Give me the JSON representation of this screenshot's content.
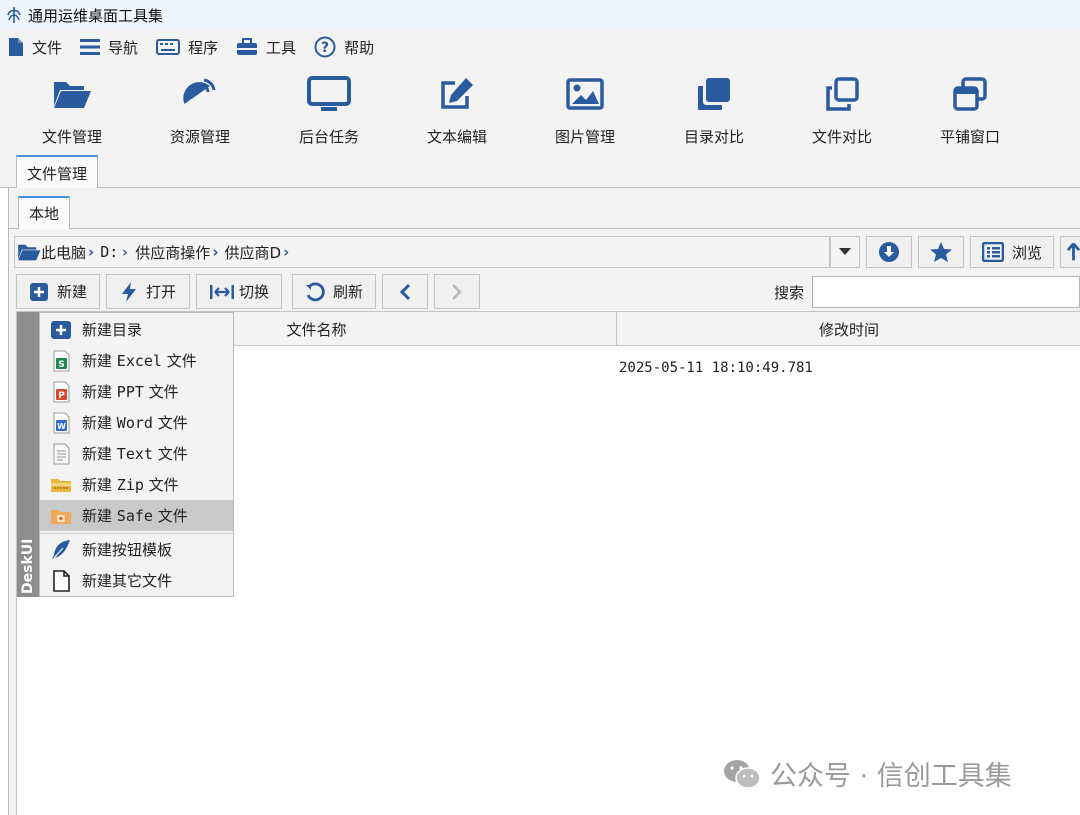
{
  "window": {
    "title": "通用运维桌面工具集"
  },
  "menu": [
    {
      "label": "文件",
      "icon": "file-icon"
    },
    {
      "label": "导航",
      "icon": "hamburger-icon"
    },
    {
      "label": "程序",
      "icon": "keyboard-icon"
    },
    {
      "label": "工具",
      "icon": "toolbox-icon"
    },
    {
      "label": "帮助",
      "icon": "help-icon"
    }
  ],
  "toolbar": [
    {
      "label": "文件管理",
      "icon": "folder-open-icon"
    },
    {
      "label": "资源管理",
      "icon": "satellite-icon"
    },
    {
      "label": "后台任务",
      "icon": "monitor-icon"
    },
    {
      "label": "文本编辑",
      "icon": "edit-icon"
    },
    {
      "label": "图片管理",
      "icon": "image-icon"
    },
    {
      "label": "目录对比",
      "icon": "clone-filled-icon"
    },
    {
      "label": "文件对比",
      "icon": "clone-outline-icon"
    },
    {
      "label": "平铺窗口",
      "icon": "window-restore-icon"
    }
  ],
  "tabs": {
    "outer": "文件管理",
    "inner": "本地"
  },
  "path": {
    "crumbs": [
      "此电脑",
      "D:",
      "供应商操作",
      "供应商D"
    ],
    "browse_label": "浏览"
  },
  "actions": {
    "new_label": "新建",
    "open_label": "打开",
    "switch_label": "切换",
    "refresh_label": "刷新",
    "search_label": "搜索",
    "search_value": ""
  },
  "table": {
    "columns": [
      "文件名称",
      "修改时间"
    ],
    "rows": [
      {
        "name": "",
        "modified": "2025-05-11 18:10:49.781"
      }
    ]
  },
  "side_brand": "DeskUI",
  "new_menu": [
    {
      "pre": "新建目录",
      "code": "",
      "post": "",
      "icon": "folder-plus-icon"
    },
    {
      "pre": "新建",
      "code": "Excel",
      "post": "文件",
      "icon": "excel-icon"
    },
    {
      "pre": "新建",
      "code": "PPT",
      "post": "文件",
      "icon": "ppt-icon"
    },
    {
      "pre": "新建",
      "code": "Word",
      "post": "文件",
      "icon": "word-icon"
    },
    {
      "pre": "新建",
      "code": "Text",
      "post": "文件",
      "icon": "text-file-icon"
    },
    {
      "pre": "新建",
      "code": "Zip",
      "post": "文件",
      "icon": "zip-icon"
    },
    {
      "pre": "新建",
      "code": "Safe",
      "post": "文件",
      "icon": "safe-icon"
    },
    {
      "pre": "新建按钮模板",
      "code": "",
      "post": "",
      "icon": "feather-icon"
    },
    {
      "pre": "新建其它文件",
      "code": "",
      "post": "",
      "icon": "blank-file-icon"
    }
  ],
  "new_menu_active_index": 6,
  "watermark": "公众号 · 信创工具集",
  "colors": {
    "accent": "#2a5b9e",
    "tab_border": "#4a90d9",
    "menu_hover": "#c9c9c9"
  }
}
